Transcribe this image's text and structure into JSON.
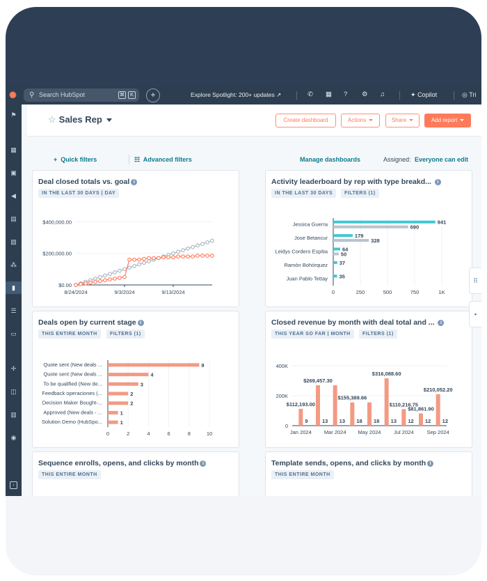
{
  "topnav": {
    "search_placeholder": "Search HubSpot",
    "kbd1": "⌘",
    "kbd2": "K",
    "spotlight": "Explore Spotlight: 200+ updates",
    "copilot": "Copilot",
    "trial": "Tri"
  },
  "header": {
    "title": "Sales Rep",
    "create_dashboard": "Create dashboard",
    "actions": "Actions",
    "share": "Share",
    "add_report": "Add report"
  },
  "filterbar": {
    "quick_filters": "Quick filters",
    "advanced_filters": "Advanced filters",
    "manage_dashboards": "Manage dashboards",
    "assigned_label": "Assigned:",
    "assigned_value": "Everyone can edit"
  },
  "cards": [
    {
      "title": "Deal closed totals vs. goal",
      "tags": [
        "IN THE LAST 30 DAYS | DAY"
      ]
    },
    {
      "title": "Activity leaderboard by rep with type breakd...",
      "tags": [
        "IN THE LAST 30 DAYS",
        "FILTERS (1)"
      ]
    },
    {
      "title": "Deals open by current stage",
      "tags": [
        "THIS ENTIRE MONTH",
        "FILTERS (1)"
      ]
    },
    {
      "title": "Closed revenue by month with deal total and ...",
      "tags": [
        "THIS YEAR SO FAR | MONTH",
        "FILTERS (1)"
      ]
    },
    {
      "title": "Sequence enrolls, opens, and clicks by month",
      "tags": [
        "THIS ENTIRE MONTH"
      ]
    },
    {
      "title": "Template sends, opens, and clicks by month",
      "tags": [
        "THIS ENTIRE MONTH"
      ]
    }
  ],
  "colors": {
    "accent": "#ff7a59",
    "teal": "#3ec8d4",
    "gray": "#b8c3cf",
    "navy": "#2d3e50",
    "salmon": "#f39a84"
  },
  "chart_data": [
    {
      "type": "line",
      "y_ticks": [
        "$400,000.00",
        "$200,000.00",
        "$0.00"
      ],
      "x_ticks": [
        "8/24/2024",
        "9/3/2024",
        "9/13/2024"
      ],
      "ylim": [
        0,
        450000
      ],
      "series": [
        {
          "values": [
            0,
            5000,
            10000,
            15000,
            20000,
            25000,
            30000,
            35000,
            40000,
            45000,
            50000,
            160000,
            160000,
            160000,
            165000,
            170000,
            170000,
            170000,
            175000,
            175000,
            175000,
            180000,
            180000,
            180000,
            180000,
            185000,
            185000,
            185000,
            185000
          ]
        },
        {
          "values": [
            0,
            10000,
            20000,
            30000,
            40000,
            50000,
            60000,
            70000,
            80000,
            90000,
            100000,
            110000,
            120000,
            130000,
            140000,
            150000,
            160000,
            170000,
            180000,
            190000,
            200000,
            210000,
            220000,
            230000,
            240000,
            250000,
            260000,
            270000,
            280000
          ]
        }
      ]
    },
    {
      "type": "bar",
      "categories": [
        "Jessica Guerra",
        "Jose Betancur",
        "Leidys Cordero Espitia",
        "Ramón Bohórquez",
        "Juan Pablo Tettay"
      ],
      "series": [
        {
          "values": [
            941,
            179,
            64,
            37,
            35
          ]
        },
        {
          "values": [
            690,
            328,
            50,
            0,
            0
          ]
        }
      ],
      "x_ticks": [
        "0",
        "250",
        "500",
        "750",
        "1K"
      ],
      "xlim": [
        0,
        1000
      ]
    },
    {
      "type": "bar",
      "categories": [
        "Quote sent (New deals ...",
        "Quote sent (New deals ...",
        "To be qualified (New de...",
        "Feedback operaciones (...",
        "Decision Maker Bought-...",
        "Approved (New deals - ...",
        "Solution Demo (HubSpo..."
      ],
      "values": [
        9,
        4,
        3,
        2,
        2,
        1,
        1
      ],
      "x_ticks": [
        "0",
        "2",
        "4",
        "6",
        "8",
        "10"
      ],
      "xlim": [
        0,
        10
      ]
    },
    {
      "type": "bar",
      "categories": [
        "Jan 2024",
        "Feb 2024",
        "Mar 2024",
        "Apr 2024",
        "May 2024",
        "Jun 2024",
        "Jul 2024",
        "Aug 2024",
        "Sep 2024"
      ],
      "x_ticks": [
        "Jan 2024",
        "Mar 2024",
        "May 2024",
        "Jul 2024",
        "Sep 2024"
      ],
      "y_ticks": [
        "400K",
        "200K",
        "0"
      ],
      "ylim": [
        0,
        400000
      ],
      "series": [
        {
          "values": [
            112193,
            269457.3,
            269457.3,
            155389.66,
            155389.66,
            316088.6,
            110216.75,
            81861.9,
            210052.2
          ]
        },
        {
          "values": [
            9,
            13,
            13,
            18,
            18,
            13,
            12,
            12,
            12
          ]
        }
      ],
      "data_labels": [
        "$112,193.00",
        "$269,457.30",
        "$155,389.66",
        "$316,088.60",
        "$110,216.75",
        "$81,861.90",
        "$210,052.20"
      ]
    }
  ]
}
